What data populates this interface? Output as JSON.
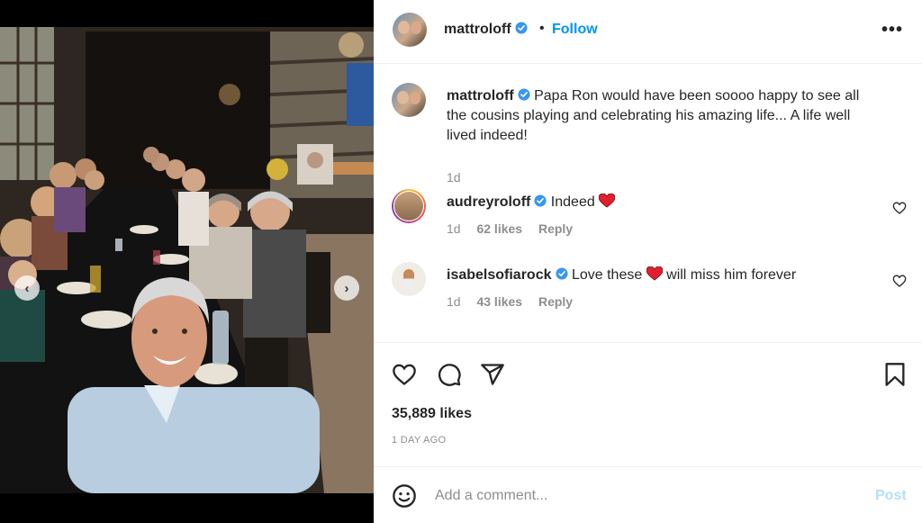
{
  "post": {
    "username": "mattroloff",
    "separator": "•",
    "follow_label": "Follow",
    "more_label": "•••",
    "colors": {
      "accent": "#0095f6",
      "verified": "#3897f0",
      "heart": "#ed4956",
      "post_disabled": "#b2dffc"
    }
  },
  "caption": {
    "username": "mattroloff",
    "text": "Papa Ron would have been soooo happy to see all the cousins playing and celebrating his amazing life... A life well lived indeed!",
    "time": "1d"
  },
  "comments": [
    {
      "username": "audreyroloff",
      "text_before": "Indeed",
      "text_after": "",
      "time": "1d",
      "likes": "62 likes",
      "reply_label": "Reply"
    },
    {
      "username": "isabelsofiarock",
      "text_before": "Love these",
      "text_after": "will miss him forever",
      "time": "1d",
      "likes": "43 likes",
      "reply_label": "Reply"
    }
  ],
  "stats": {
    "likes": "35,889 likes",
    "time_ago": "1 DAY AGO"
  },
  "composer": {
    "placeholder": "Add a comment...",
    "post_label": "Post"
  },
  "carousel": {
    "prev_label": "‹",
    "next_label": "›",
    "slide_count": 7,
    "active_index": 6
  },
  "icons": [
    "verified-badge-icon",
    "heart-icon",
    "comment-icon",
    "share-icon",
    "bookmark-icon",
    "emoji-icon",
    "more-options-icon",
    "chevron-left-icon",
    "chevron-right-icon"
  ]
}
